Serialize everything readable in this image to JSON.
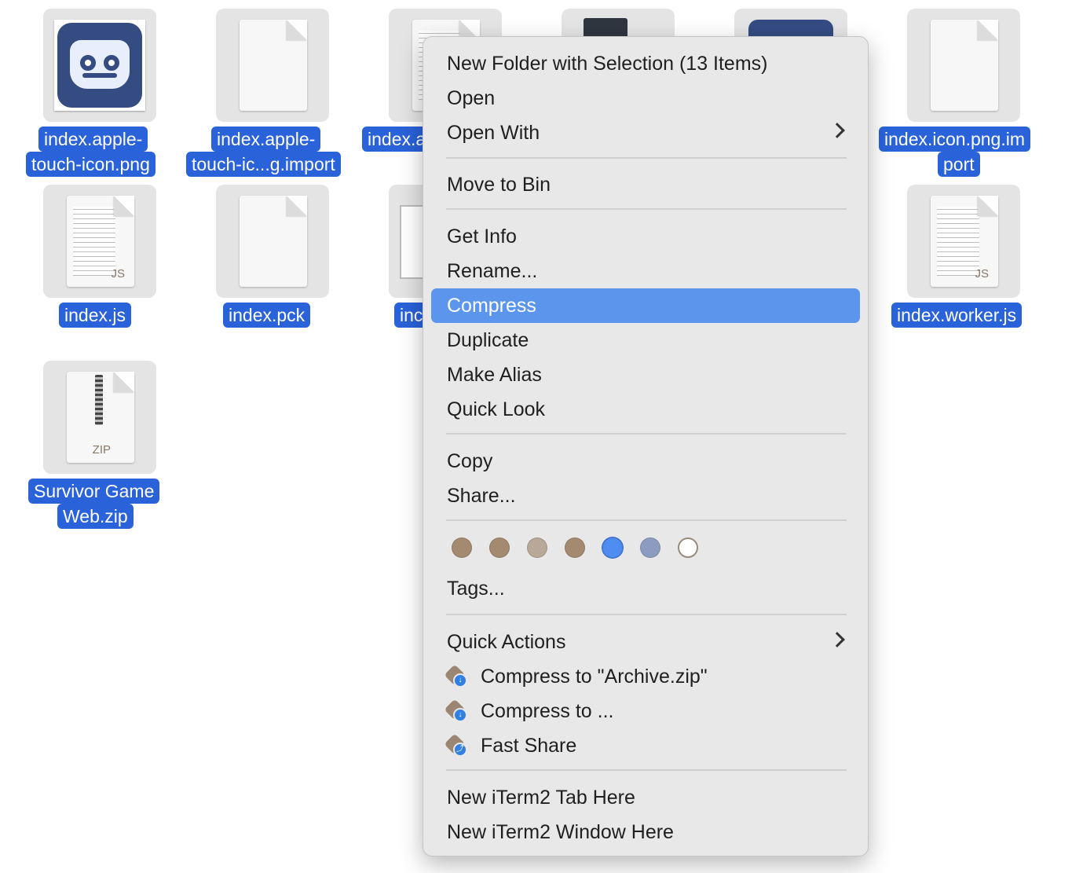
{
  "files": [
    {
      "name_line1": "index.apple-",
      "name_line2": "touch-icon.png"
    },
    {
      "name_line1": "index.apple-",
      "name_line2": "touch-ic...g.import"
    },
    {
      "name_line1": "index.a",
      "name_line2": ""
    },
    {
      "name_line1": "index.icon.png.im",
      "name_line2": "port"
    },
    {
      "name_line1": "index.js",
      "name_line2": "",
      "ext": "JS"
    },
    {
      "name_line1": "index.pck",
      "name_line2": ""
    },
    {
      "name_line1": "inc",
      "name_line2": ""
    },
    {
      "name_line1": "index.worker.js",
      "name_line2": "",
      "ext": "JS"
    },
    {
      "name_line1": "Survivor Game",
      "name_line2": "Web.zip",
      "ext": "ZIP"
    }
  ],
  "menu": {
    "new_folder": "New Folder with Selection (13 Items)",
    "open": "Open",
    "open_with": "Open With",
    "move_to_bin": "Move to Bin",
    "get_info": "Get Info",
    "rename": "Rename...",
    "compress": "Compress",
    "duplicate": "Duplicate",
    "make_alias": "Make Alias",
    "quick_look": "Quick Look",
    "copy": "Copy",
    "share": "Share...",
    "tags": "Tags...",
    "quick_actions": "Quick Actions",
    "compress_archive": "Compress to \"Archive.zip\"",
    "compress_to": "Compress to ...",
    "fast_share": "Fast Share",
    "iterm_tab": "New iTerm2 Tab Here",
    "iterm_window": "New iTerm2 Window Here",
    "highlighted": "Compress"
  },
  "tag_colors": [
    "#a58a72",
    "#a58a72",
    "#b8a898",
    "#a58a72",
    "#4f8ef0",
    "#8c9cc0",
    "#ffffff"
  ],
  "colors": {
    "selection": "#2a62d9",
    "menu_highlight": "#5b96ec"
  }
}
